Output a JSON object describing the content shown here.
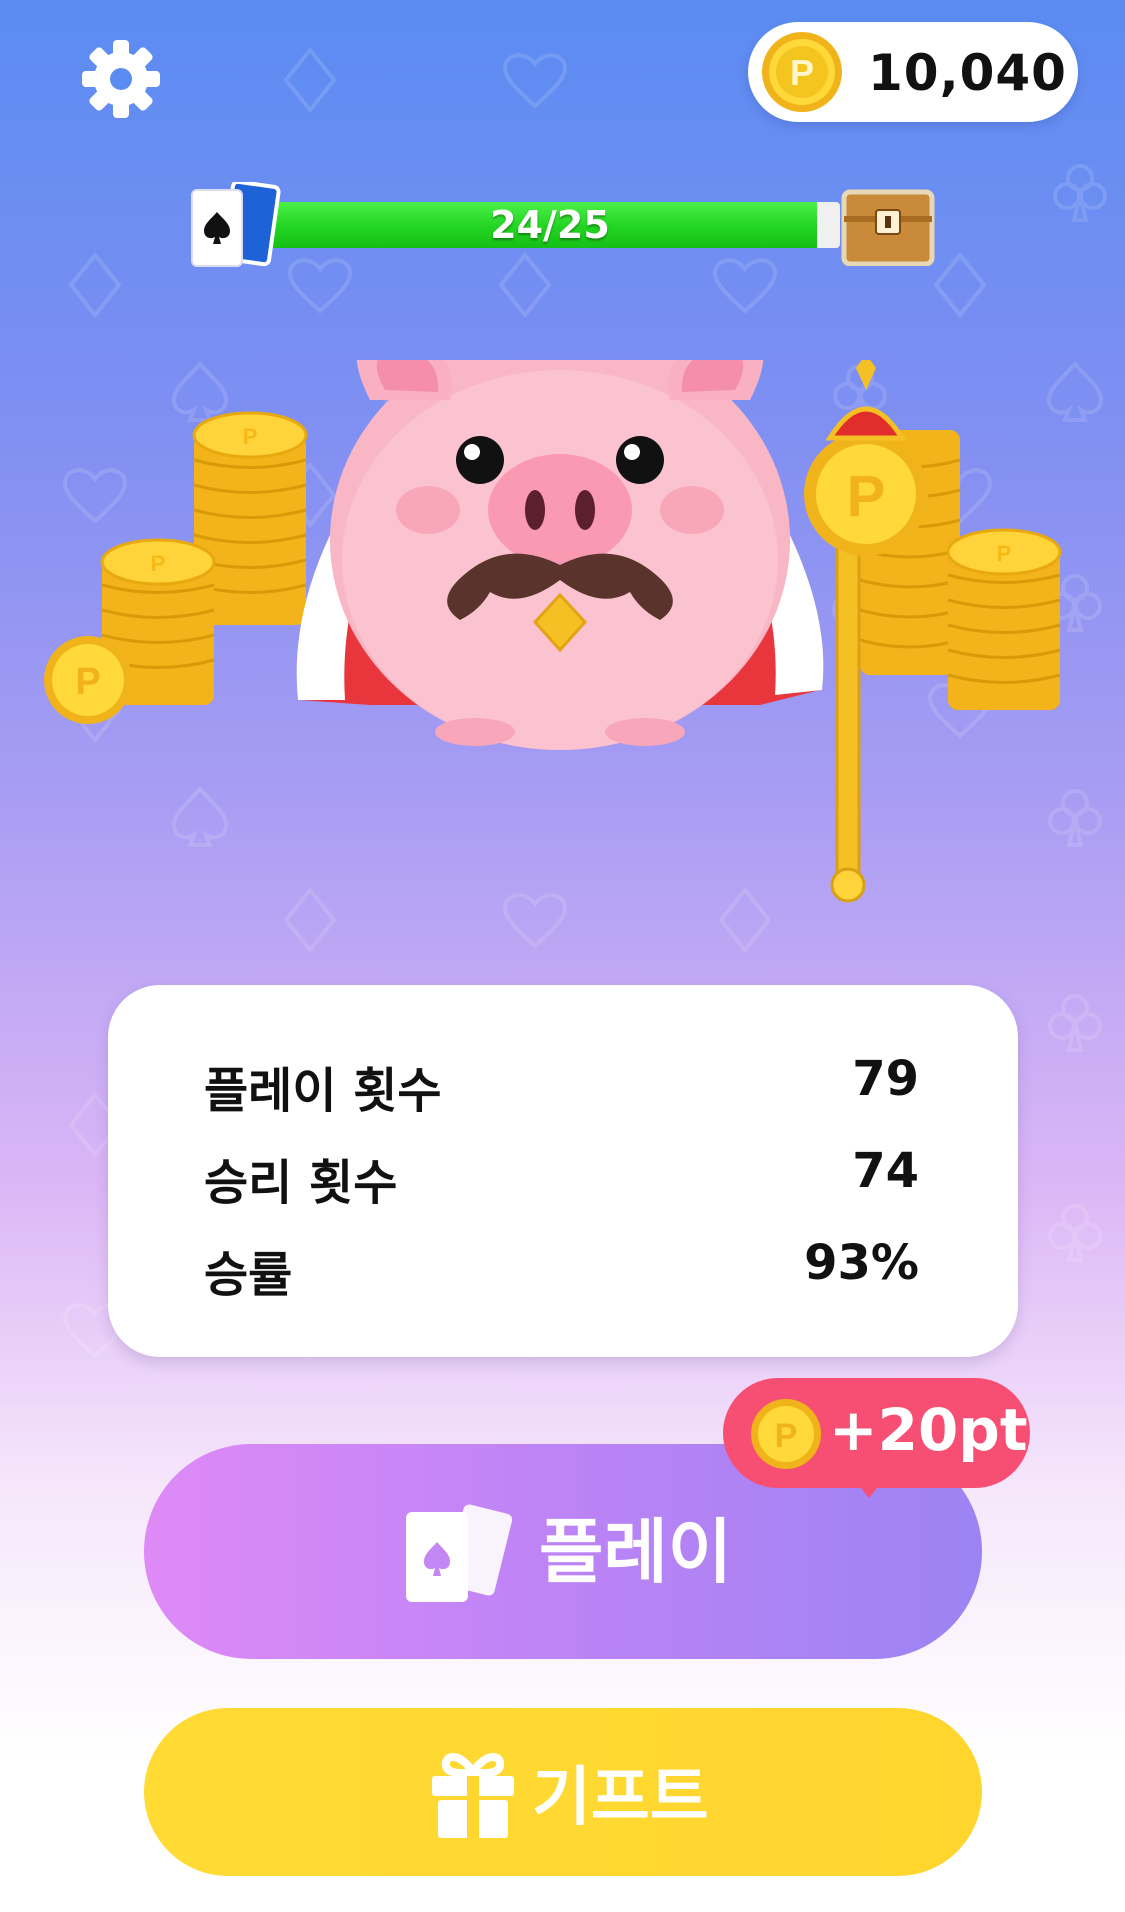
{
  "coins": {
    "balance": "10,040",
    "symbol": "P"
  },
  "progress": {
    "text": "24/25",
    "current": 24,
    "goal": 25
  },
  "stats": {
    "rows": [
      {
        "label": "플레이 횟수",
        "value": "79"
      },
      {
        "label": "승리 횟수",
        "value": "74"
      },
      {
        "label": "승률",
        "value": "93%"
      }
    ]
  },
  "play": {
    "label": "플레이",
    "reward": "+20pt"
  },
  "gift": {
    "label": "기프트"
  },
  "colors": {
    "coin_gold": "#f5c51f",
    "play_gradient_start": "#de8af7",
    "play_gradient_end": "#9c83f3",
    "gift_yellow": "#ffd52e",
    "reward_pink": "#f64f73",
    "progress_green": "#22d421"
  },
  "icons": {
    "settings": "gear-icon",
    "coin": "coin-icon",
    "cards": "cards-icon",
    "chest": "treasure-chest-icon",
    "gift": "gift-icon"
  }
}
